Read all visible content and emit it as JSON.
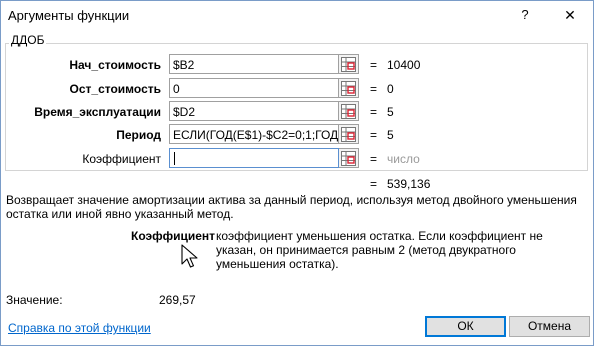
{
  "window": {
    "title": "Аргументы функции",
    "help_label": "?",
    "close_label": "✕"
  },
  "function_name": "ДДОБ",
  "args": [
    {
      "label": "Нач_стоимость",
      "value": "$B2",
      "result": "10400",
      "bold": true
    },
    {
      "label": "Ост_стоимость",
      "value": "0",
      "result": "0",
      "bold": true
    },
    {
      "label": "Время_эксплуатации",
      "value": "$D2",
      "result": "5",
      "bold": true
    },
    {
      "label": "Период",
      "value": "ЕСЛИ(ГОД(E$1)-$C2=0;1;ГОД(E$",
      "result": "5",
      "bold": true
    },
    {
      "label": "Коэффициент",
      "value": "",
      "result": "число",
      "bold": false
    }
  ],
  "formula_result": "539,136",
  "description": "Возвращает значение амортизации актива за данный период, используя метод двойного уменьшения остатка или иной явно указанный метод.",
  "arg_help": {
    "name": "Коэффициент",
    "text": "коэффициент уменьшения остатка. Если коэффициент не указан, он принимается равным 2 (метод двукратного уменьшения остатка)."
  },
  "value_label": "Значение:",
  "value": "269,57",
  "help_link": "Справка по этой функции",
  "ok_label": "ОК",
  "cancel_label": "Отмена",
  "equals": "=",
  "colors": {
    "border": "#7a9cc8",
    "link": "#0066cc",
    "ok_border": "#0078d7",
    "muted": "#9a9a9a"
  }
}
